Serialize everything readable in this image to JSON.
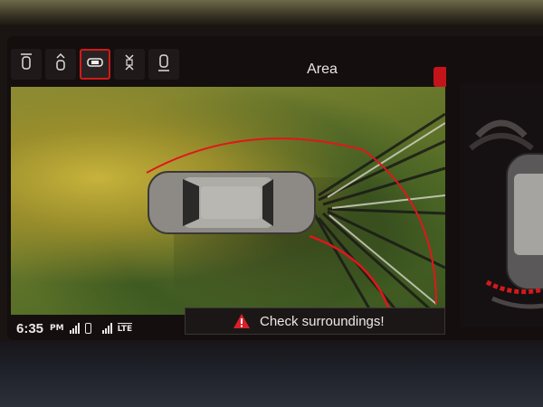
{
  "header": {
    "title": "Area"
  },
  "toolbar": {
    "buttons": [
      {
        "icon": "front-view-icon",
        "active": false
      },
      {
        "icon": "front-rear-view-icon",
        "active": false
      },
      {
        "icon": "top-area-view-icon",
        "active": true
      },
      {
        "icon": "side-view-icon",
        "active": false
      },
      {
        "icon": "rear-view-icon",
        "active": false
      }
    ]
  },
  "status_bar": {
    "time": "6:35",
    "ampm": "PM",
    "network": "LTE"
  },
  "alert": {
    "message": "Check surroundings!",
    "icon": "warning-triangle-icon",
    "icon_color": "#d9202a"
  },
  "colors": {
    "accent": "#c4141b",
    "guide_line": "#e0161c"
  }
}
